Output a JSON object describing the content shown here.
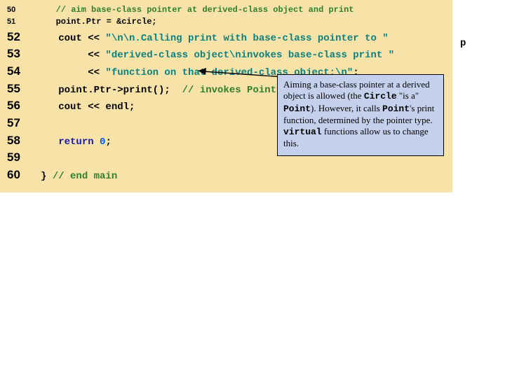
{
  "lines": {
    "l50": {
      "num": "50",
      "code": "   // aim base-class pointer at derived-class object and print"
    },
    "l51": {
      "num": "51",
      "code": "   point.Ptr = &circle;"
    },
    "l52": {
      "num": "52",
      "p1": "   cout << ",
      "s1": "\"\\n\\n.Calling print with base-class pointer to \""
    },
    "l53": {
      "num": "53",
      "p1": "        << ",
      "s1": "\"derived-class object\\ninvokes base-class print \""
    },
    "l54": {
      "num": "54",
      "p1": "        << ",
      "s1": "\"function on that derived-class object:\\n\"",
      "p2": ";"
    },
    "l55": {
      "num": "55",
      "p1": "   point.Ptr->print();  ",
      "c1": "// invokes Point's print"
    },
    "l56": {
      "num": "56",
      "code": "   cout << endl;"
    },
    "l57": {
      "num": "57",
      "code": ""
    },
    "l58": {
      "num": "58",
      "p1": "   ",
      "kw": "return",
      "p2": " ",
      "nm": "0",
      "p3": ";"
    },
    "l59": {
      "num": "59",
      "code": ""
    },
    "l60": {
      "num": "60",
      "p1": "} ",
      "c1": "// end main"
    }
  },
  "callout": {
    "t1": "Aiming a base-class pointer at a derived object is allowed (the ",
    "m1": "Circle",
    "t2": " \"is a\" ",
    "m2": "Point",
    "t3": "). However, it calls ",
    "m3": "Point",
    "t4": "'s print function, determined by the pointer type. ",
    "m4": "virtual",
    "t5": " functions allow us to change this."
  },
  "outside": {
    "p": "p"
  }
}
